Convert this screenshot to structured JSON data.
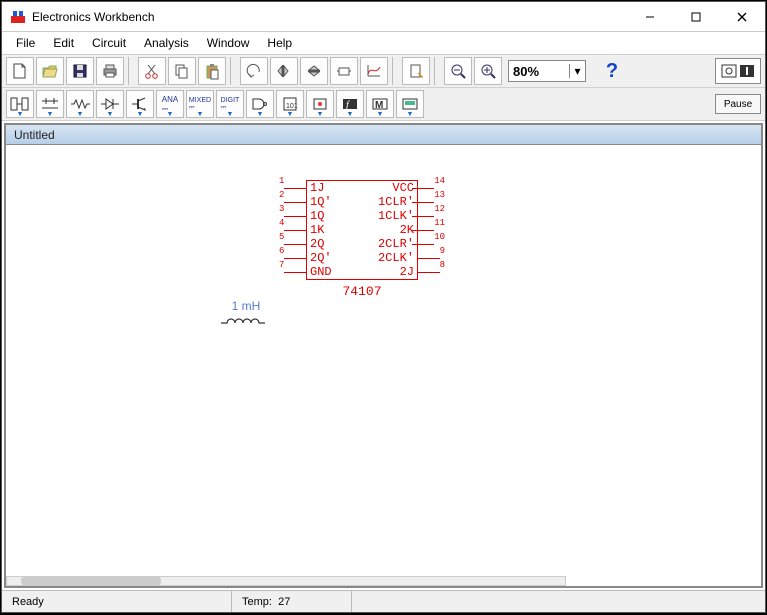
{
  "window": {
    "title": "Electronics Workbench",
    "controls": {
      "minimize": "—",
      "maximize": "▢",
      "close": "✕"
    }
  },
  "menu": [
    "File",
    "Edit",
    "Circuit",
    "Analysis",
    "Window",
    "Help"
  ],
  "toolbar1": {
    "zoom_value": "80%",
    "help": "?",
    "pause": "Pause"
  },
  "document": {
    "title": "Untitled"
  },
  "status": {
    "ready": "Ready",
    "temp_label": "Temp:",
    "temp_value": "27"
  },
  "inductor": {
    "value": "1 mH"
  },
  "chip": {
    "name": "74107",
    "left_pins": [
      {
        "num": "1",
        "label": "1J"
      },
      {
        "num": "2",
        "label": "1Q'"
      },
      {
        "num": "3",
        "label": "1Q"
      },
      {
        "num": "4",
        "label": "1K"
      },
      {
        "num": "5",
        "label": "2Q"
      },
      {
        "num": "6",
        "label": "2Q'"
      },
      {
        "num": "7",
        "label": "GND"
      }
    ],
    "right_pins": [
      {
        "num": "14",
        "label": "VCC"
      },
      {
        "num": "13",
        "label": "1CLR'"
      },
      {
        "num": "12",
        "label": "1CLK'"
      },
      {
        "num": "11",
        "label": "2K"
      },
      {
        "num": "10",
        "label": "2CLR'"
      },
      {
        "num": "9",
        "label": "2CLK'"
      },
      {
        "num": "8",
        "label": "2J"
      }
    ]
  }
}
